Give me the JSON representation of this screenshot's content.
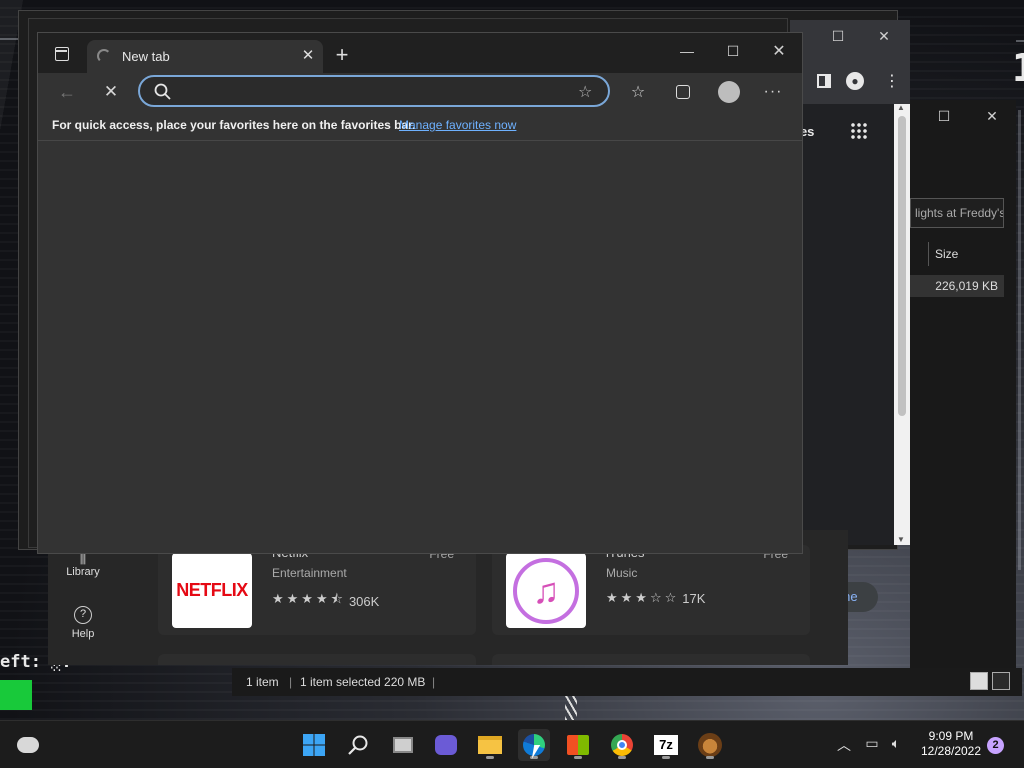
{
  "desktop": {
    "bg_text_1": "eft: ░:",
    "bg_text_2": "1"
  },
  "edge": {
    "tab_title": "New tab",
    "address_placeholder": "",
    "address_value": "",
    "favbar_text": "For quick access, place your favorites here on the favorites bar.",
    "favbar_link": "Manage favorites now"
  },
  "chrome_window": {
    "partial_label": "ges",
    "customize_label": "ze Chrome"
  },
  "explorer": {
    "search_placeholder": "lights at Freddy's",
    "size_header": "Size",
    "size_value": "226,019 KB",
    "status_items": "1 item",
    "status_selected": "1 item selected  220 MB"
  },
  "store": {
    "nav_library": "Library",
    "nav_help": "Help",
    "cards": [
      {
        "name": "Netflix",
        "category": "Entertainment",
        "price": "Free",
        "rating_count": "306K",
        "rating": 4.5,
        "logo_text": "NETFLIX"
      },
      {
        "name": "iTunes",
        "category": "Music",
        "price": "Free",
        "rating_count": "17K",
        "rating": 3.0
      }
    ]
  },
  "taskbar": {
    "time": "9:09 PM",
    "date": "12/28/2022",
    "notification_count": "2",
    "seven_zip_label": "7z"
  },
  "colors": {
    "accent": "#7aa7d8",
    "link": "#6eb1ff",
    "netflix_red": "#e50914",
    "edge_bg": "#333333",
    "taskbar_bg": "#1c1c1c"
  }
}
